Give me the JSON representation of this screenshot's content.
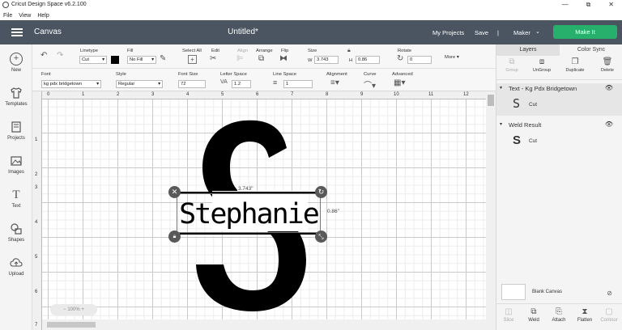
{
  "window": {
    "title": "Cricut Design Space  v6.2.100",
    "minimize": "—",
    "maximize": "⧉",
    "close": "✕"
  },
  "menu": [
    "File",
    "View",
    "Help"
  ],
  "header": {
    "section": "Canvas",
    "doc_title": "Untitled*",
    "my_projects": "My Projects",
    "save": "Save",
    "separator": "|",
    "machine": "Maker",
    "make_it": "Make It"
  },
  "sidebar": [
    {
      "label": "New",
      "icon": "plus-icon"
    },
    {
      "label": "Templates",
      "icon": "shirt-icon"
    },
    {
      "label": "Projects",
      "icon": "projects-icon"
    },
    {
      "label": "Images",
      "icon": "images-icon"
    },
    {
      "label": "Text",
      "icon": "text-icon"
    },
    {
      "label": "Shapes",
      "icon": "shapes-icon"
    },
    {
      "label": "Upload",
      "icon": "upload-icon"
    }
  ],
  "toolbar": {
    "linetype_label": "Linetype",
    "linetype_value": "Cut",
    "fill_label": "Fill",
    "fill_value": "No Fill",
    "select_all": "Select All",
    "edit": "Edit",
    "align": "Align",
    "arrange": "Arrange",
    "flip": "Flip",
    "size_label": "Size",
    "w_label": "W",
    "w_value": "3.743",
    "h_label": "H",
    "h_value": "0.86",
    "rotate_label": "Rotate",
    "rotate_value": "0",
    "more": "More ▾",
    "font_label": "Font",
    "font_value": "kg pdx bridgetown",
    "style_label": "Style",
    "style_value": "Regular",
    "font_size_label": "Font Size",
    "font_size_value": "72",
    "letter_space_label": "Letter Space",
    "letter_space_value": "1.2",
    "line_space_label": "Line Space",
    "line_space_value": "1",
    "alignment_label": "Alignment",
    "curve_label": "Curve",
    "advanced_label": "Advanced"
  },
  "ruler": {
    "top": [
      "0",
      "1",
      "2",
      "3",
      "4",
      "5",
      "6",
      "7",
      "8",
      "9",
      "10",
      "11",
      "12"
    ],
    "left": [
      "1",
      "2",
      "3",
      "4",
      "5",
      "6",
      "7"
    ]
  },
  "canvas": {
    "width_readout": "3.743\"",
    "height_readout": "0.86\"",
    "design_text": "Stephanie",
    "monogram": "S",
    "zoom": "100%"
  },
  "layers_panel": {
    "tabs": [
      "Layers",
      "Color Sync"
    ],
    "actions": [
      "Group",
      "UnGroup",
      "Duplicate",
      "Delete"
    ],
    "layers": [
      {
        "title": "Text - Kg Pdx Bridgetown",
        "sub": "Cut"
      },
      {
        "title": "Weld Result",
        "sub": "Cut"
      }
    ],
    "blank_canvas": "Blank Canvas",
    "bottom": [
      "Slice",
      "Weld",
      "Attach",
      "Flatten",
      "Contour"
    ]
  }
}
